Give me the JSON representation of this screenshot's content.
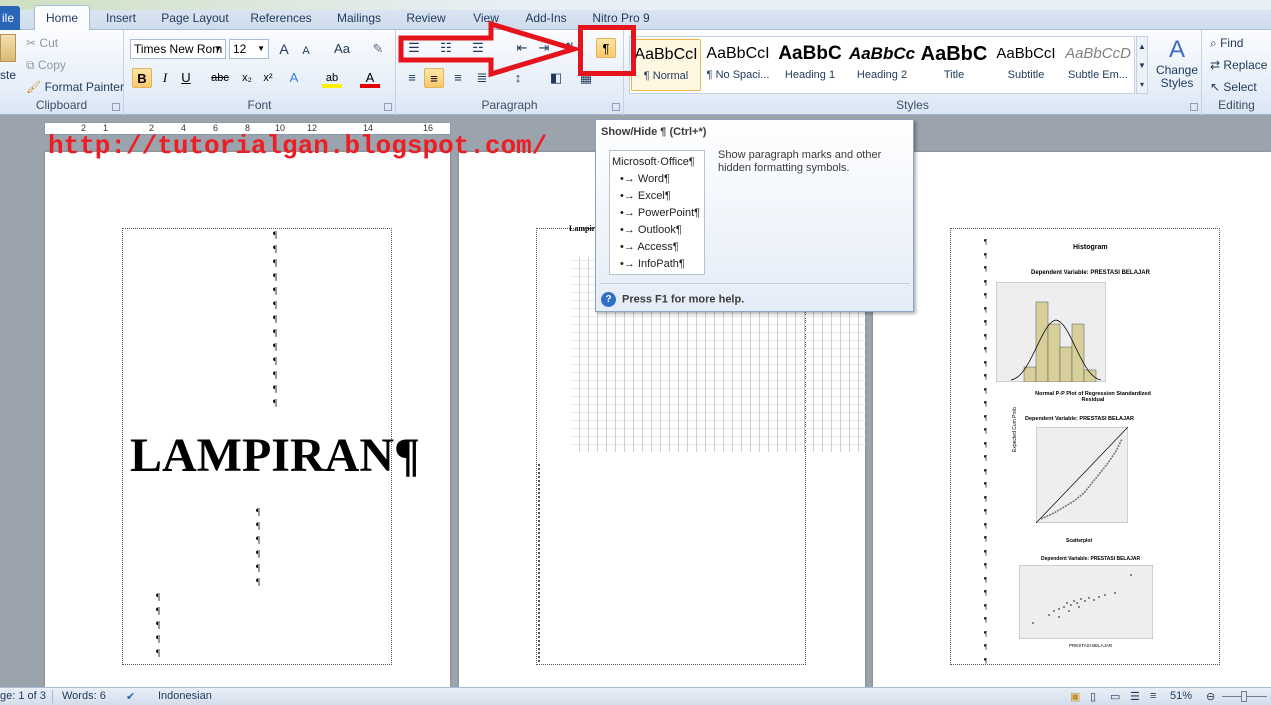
{
  "tabs": [
    "ile",
    "Home",
    "Insert",
    "Page Layout",
    "References",
    "Mailings",
    "Review",
    "View",
    "Add-Ins",
    "Nitro Pro 9"
  ],
  "clipboard": {
    "paste": "ste",
    "cut": "Cut",
    "copy": "Copy",
    "format_painter": "Format Painter",
    "label": "Clipboard"
  },
  "font": {
    "name": "Times New Rom",
    "size": "12",
    "label": "Font",
    "grow": "A",
    "shrink": "A",
    "case": "Aa",
    "bold": "B",
    "italic": "I",
    "underline": "U",
    "strike": "abc",
    "sub": "x₂",
    "sup": "x²",
    "highlight": "ab",
    "color": "A"
  },
  "paragraph": {
    "label": "Paragraph",
    "show_hide": "¶"
  },
  "styles": {
    "label": "Styles",
    "items": [
      {
        "preview": "AaBbCcI",
        "name": "¶ Normal"
      },
      {
        "preview": "AaBbCcI",
        "name": "¶ No Spaci..."
      },
      {
        "preview": "AaBbC",
        "name": "Heading 1"
      },
      {
        "preview": "AaBbCc",
        "name": "Heading 2"
      },
      {
        "preview": "AaBbC",
        "name": "Title"
      },
      {
        "preview": "AaBbCcI",
        "name": "Subtitle"
      },
      {
        "preview": "AaBbCcD",
        "name": "Subtle Em..."
      }
    ],
    "change_styles": "Change Styles"
  },
  "editing": {
    "label": "Editing",
    "find": "Find",
    "replace": "Replace",
    "select": "Select"
  },
  "ruler": {
    "marks": [
      "2",
      "1",
      "2",
      "4",
      "6",
      "8",
      "10",
      "12",
      "14",
      "16"
    ]
  },
  "watermark_url": "http://tutorialgan.blogspot.com/",
  "page1": {
    "heading": "LAMPIRAN¶"
  },
  "page2": {
    "heading": "Lampir"
  },
  "page3": {
    "histogram_title": "Histogram",
    "dv1": "Dependent Variable: PRESTASI BELAJAR",
    "pp_title": "Normal P-P Plot of Regression Standardized Residual",
    "dv2": "Dependent Variable: PRESTASI BELAJAR",
    "pp_ylabel": "Expected Cum Prob",
    "scatter_title": "Scatterplot",
    "dv3": "Dependent Variable: PRESTASI BELAJAR",
    "scatter_xlabel": "PRESTASI BELAJAR"
  },
  "tooltip": {
    "title": "Show/Hide ¶ (Ctrl+*)",
    "image_lines": [
      "Microsoft·Office¶",
      "Word¶",
      "Excel¶",
      "PowerPoint¶",
      "Outlook¶",
      "Access¶",
      "InfoPath¶"
    ],
    "description": "Show paragraph marks and other hidden formatting symbols.",
    "help": "Press F1 for more help."
  },
  "status": {
    "page": "ge: 1 of 3",
    "words": "Words: 6",
    "language": "Indonesian",
    "zoom": "51%"
  }
}
